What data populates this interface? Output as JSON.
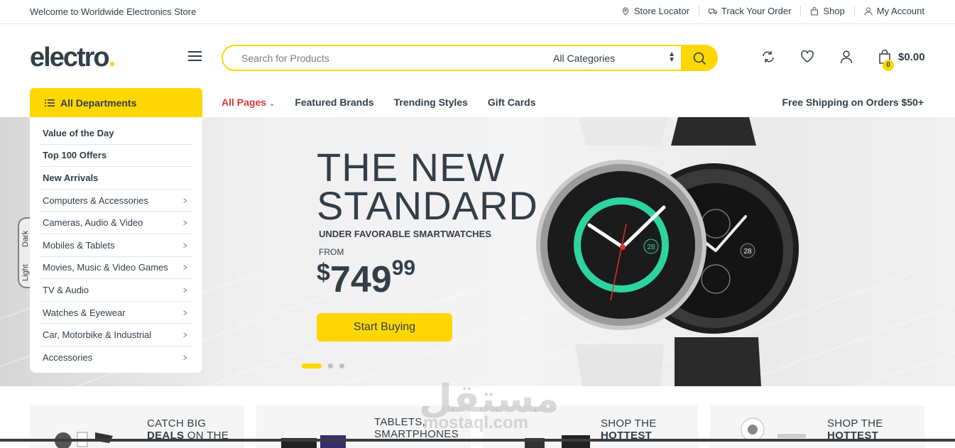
{
  "topbar": {
    "welcome": "Welcome to Worldwide Electronics Store",
    "links": [
      {
        "label": "Store Locator",
        "icon": "map-pin-icon"
      },
      {
        "label": "Track Your Order",
        "icon": "truck-icon"
      },
      {
        "label": "Shop",
        "icon": "shopping-bag-icon"
      },
      {
        "label": "My Account",
        "icon": "user-icon"
      }
    ]
  },
  "header": {
    "logo": "electro",
    "logo_dot": ".",
    "search_placeholder": "Search for Products",
    "category_selected": "All Categories",
    "cart_count": "0",
    "cart_total": "$0.00"
  },
  "nav": {
    "departments_label": "All Departments",
    "links": [
      "All Pages",
      "Featured Brands",
      "Trending Styles",
      "Gift Cards"
    ],
    "free_shipping": "Free Shipping on Orders $50+"
  },
  "departments": [
    {
      "label": "Value of the Day",
      "bold": true,
      "arrow": false
    },
    {
      "label": "Top 100 Offers",
      "bold": true,
      "arrow": false
    },
    {
      "label": "New Arrivals",
      "bold": true,
      "arrow": false
    },
    {
      "label": "Computers & Accessories",
      "bold": false,
      "arrow": true
    },
    {
      "label": "Cameras, Audio & Video",
      "bold": false,
      "arrow": true
    },
    {
      "label": "Mobiles & Tablets",
      "bold": false,
      "arrow": true
    },
    {
      "label": "Movies, Music & Video Games",
      "bold": false,
      "arrow": true
    },
    {
      "label": "TV & Audio",
      "bold": false,
      "arrow": true
    },
    {
      "label": "Watches & Eyewear",
      "bold": false,
      "arrow": true
    },
    {
      "label": "Car, Motorbike & Industrial",
      "bold": false,
      "arrow": true
    },
    {
      "label": "Accessories",
      "bold": false,
      "arrow": true
    }
  ],
  "hero": {
    "title_line1": "THE NEW",
    "title_line2": "STANDARD",
    "subtitle": "UNDER FAVORABLE SMARTWATCHES",
    "from_label": "FROM",
    "price_currency": "$",
    "price_main": "749",
    "price_cents": "99",
    "cta": "Start Buying",
    "slides": 3,
    "active_slide": 1,
    "watch_date": "28"
  },
  "theme_toggle": {
    "dark": "Dark",
    "light": "Light"
  },
  "promos": [
    {
      "line1": "CATCH BIG",
      "line2_bold": "DEALS",
      "line2_rest": " ON THE"
    },
    {
      "line1": "TABLETS,",
      "line2_bold": "",
      "line2_rest": "SMARTPHONES"
    },
    {
      "line1": "SHOP THE",
      "line2_bold": "HOTTEST",
      "line2_rest": ""
    },
    {
      "line1": "SHOP THE",
      "line2_bold": "HOTTEST",
      "line2_rest": ""
    }
  ],
  "watermark": {
    "arabic": "مستقل",
    "latin": "mostaql.com"
  },
  "colors": {
    "accent": "#fed700",
    "text": "#333e48",
    "red": "#df3737"
  }
}
